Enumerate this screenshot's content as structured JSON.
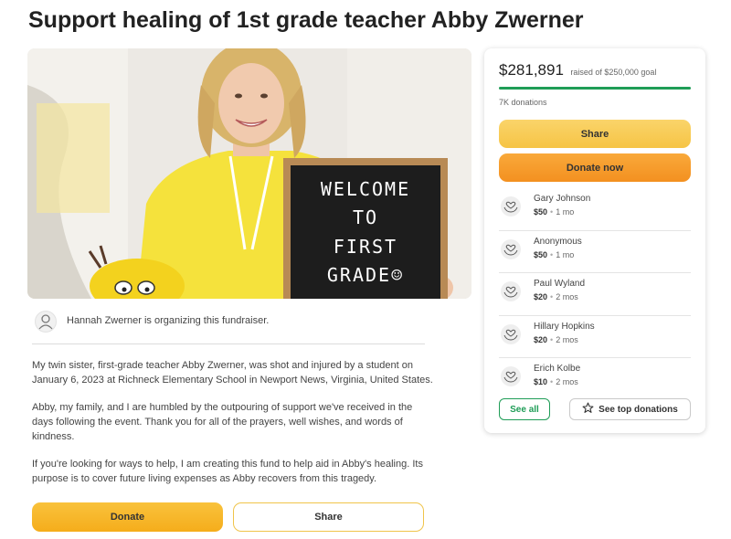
{
  "page": {
    "title": "Support healing of 1st grade teacher Abby Zwerner"
  },
  "hero": {
    "sign_lines": [
      "WELCOME",
      "TO",
      "FIRST",
      "GRADE☺"
    ]
  },
  "organizer": {
    "text": "Hannah Zwerner is organizing this fundraiser.",
    "icon": "user-icon"
  },
  "story": {
    "paragraphs": [
      "My twin sister, first-grade teacher Abby Zwerner, was shot and injured by a student on January 6, 2023 at Richneck Elementary School in Newport News, Virginia, United States.",
      "Abby, my family, and I are humbled by the outpouring of support we've received in the days following the event. Thank you for all of the prayers, well wishes, and words of kindness.",
      "If you're looking for ways to help, I am creating this fund to help aid in Abby's healing. Its purpose is to cover future living expenses as Abby recovers from this tragedy."
    ]
  },
  "bottom_actions": {
    "donate_label": "Donate",
    "share_label": "Share"
  },
  "campaign": {
    "raised": "$281,891",
    "goal_text": "raised of $250,000 goal",
    "progress_fraction": 1.0,
    "donation_count": "7K donations",
    "share_label": "Share",
    "donate_label": "Donate now",
    "see_all_label": "See all",
    "top_donations_label": "See top donations",
    "colors": {
      "accent_green": "#1f9d57",
      "donate_orange": "#f39020",
      "share_yellow": "#f6c445"
    }
  },
  "donations": [
    {
      "name": "Gary Johnson",
      "amount": "$50",
      "time": "1 mo",
      "icon": "heart-hands-icon"
    },
    {
      "name": "Anonymous",
      "amount": "$50",
      "time": "1 mo",
      "icon": "heart-hands-icon"
    },
    {
      "name": "Paul Wyland",
      "amount": "$20",
      "time": "2 mos",
      "icon": "heart-hands-icon"
    },
    {
      "name": "Hillary Hopkins",
      "amount": "$20",
      "time": "2 mos",
      "icon": "heart-hands-icon"
    },
    {
      "name": "Erich Kolbe",
      "amount": "$10",
      "time": "2 mos",
      "icon": "heart-hands-icon"
    }
  ]
}
